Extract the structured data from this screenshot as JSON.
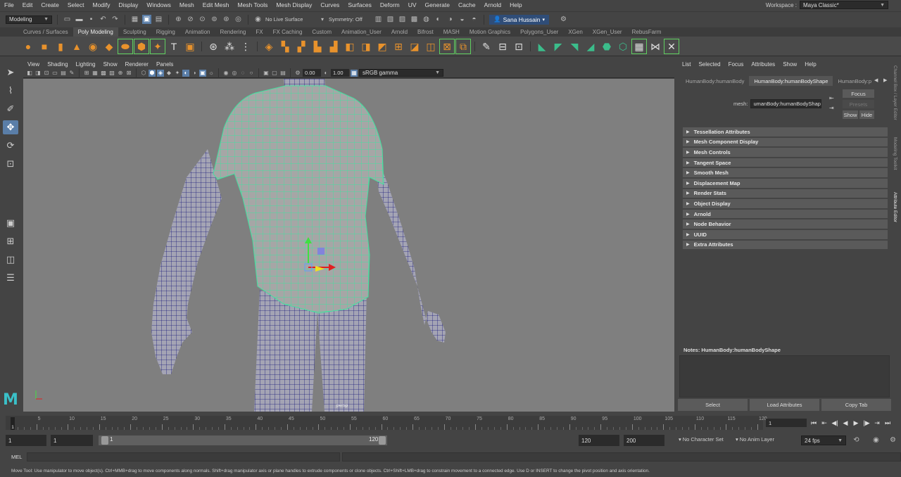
{
  "menubar": {
    "items": [
      "File",
      "Edit",
      "Create",
      "Select",
      "Modify",
      "Display",
      "Windows",
      "Mesh",
      "Edit Mesh",
      "Mesh Tools",
      "Mesh Display",
      "Curves",
      "Surfaces",
      "Deform",
      "UV",
      "Generate",
      "Cache",
      "Arnold",
      "Help"
    ],
    "workspace_label": "Workspace :",
    "workspace_value": "Maya Classic*"
  },
  "statusline": {
    "mode": "Modeling",
    "live_surface": "No Live Surface",
    "symmetry": "Symmetry: Off",
    "user": "Sana Hussain"
  },
  "shelf_tabs": {
    "items": [
      "Curves / Surfaces",
      "Poly Modeling",
      "Sculpting",
      "Rigging",
      "Animation",
      "Rendering",
      "FX",
      "FX Caching",
      "Custom",
      "Animation_User",
      "Arnold",
      "Bifrost",
      "MASH",
      "Motion Graphics",
      "Polygons_User",
      "XGen",
      "XGen_User",
      "RebusFarm"
    ],
    "active": "Poly Modeling"
  },
  "viewport": {
    "menu": [
      "View",
      "Shading",
      "Lighting",
      "Show",
      "Renderer",
      "Panels"
    ],
    "exposure": "0.00",
    "gamma": "1.00",
    "color_space": "sRGB gamma",
    "camera": "persp"
  },
  "attribute_editor": {
    "menu": [
      "List",
      "Selected",
      "Focus",
      "Attributes",
      "Show",
      "Help"
    ],
    "tabs": [
      "HumanBody:humanBody",
      "HumanBody:humanBodyShape",
      "HumanBody:p"
    ],
    "active_tab": "HumanBody:humanBodyShape",
    "mesh_label": "mesh:",
    "mesh_value": "umanBody:humanBodyShape",
    "focus_button": "Focus",
    "presets_button": "Presets",
    "show_button": "Show",
    "hide_button": "Hide",
    "sections": [
      "Tessellation Attributes",
      "Mesh Component Display",
      "Mesh Controls",
      "Tangent Space",
      "Smooth Mesh",
      "Displacement Map",
      "Render Stats",
      "Object Display",
      "Arnold",
      "Node Behavior",
      "UUID",
      "Extra Attributes"
    ],
    "notes_label": "Notes:  HumanBody:humanBodyShape",
    "select_button": "Select",
    "load_button": "Load Attributes",
    "copy_button": "Copy Tab"
  },
  "side_tabs": [
    "Channel Box / Layer Editor",
    "Modeling Toolkit",
    "Attribute Editor"
  ],
  "timeline": {
    "labels": [
      "5",
      "10",
      "15",
      "20",
      "25",
      "30",
      "35",
      "40",
      "45",
      "50",
      "55",
      "60",
      "65",
      "70",
      "75",
      "80",
      "85",
      "90",
      "95",
      "100",
      "105",
      "110",
      "115",
      "120"
    ],
    "current_frame": "1",
    "current_frame_field": "1"
  },
  "range": {
    "start": "1",
    "playback_start": "1",
    "slider_start": "1",
    "slider_end": "120",
    "playback_end": "120",
    "end": "200",
    "character_set": "No Character Set",
    "anim_layer": "No Anim Layer",
    "fps": "24 fps"
  },
  "cmdline": {
    "lang": "MEL"
  },
  "helpline": {
    "text": "Move Tool: Use manipulator to move object(s). Ctrl+MMB+drag to move components along normals. Shift+drag manipulator axis or plane handles to extrude components or clone objects. Ctrl+Shift+LMB+drag to constrain movement to a connected edge. Use D or INSERT to change the pivot position and axis orientation."
  },
  "colors": {
    "accent": "#2f4d78",
    "wire_shirt": "#44e0a0",
    "wire_body": "#1a1a7a",
    "viewport_bg": "#7f7f7f",
    "logo": "#3ac0c8"
  }
}
